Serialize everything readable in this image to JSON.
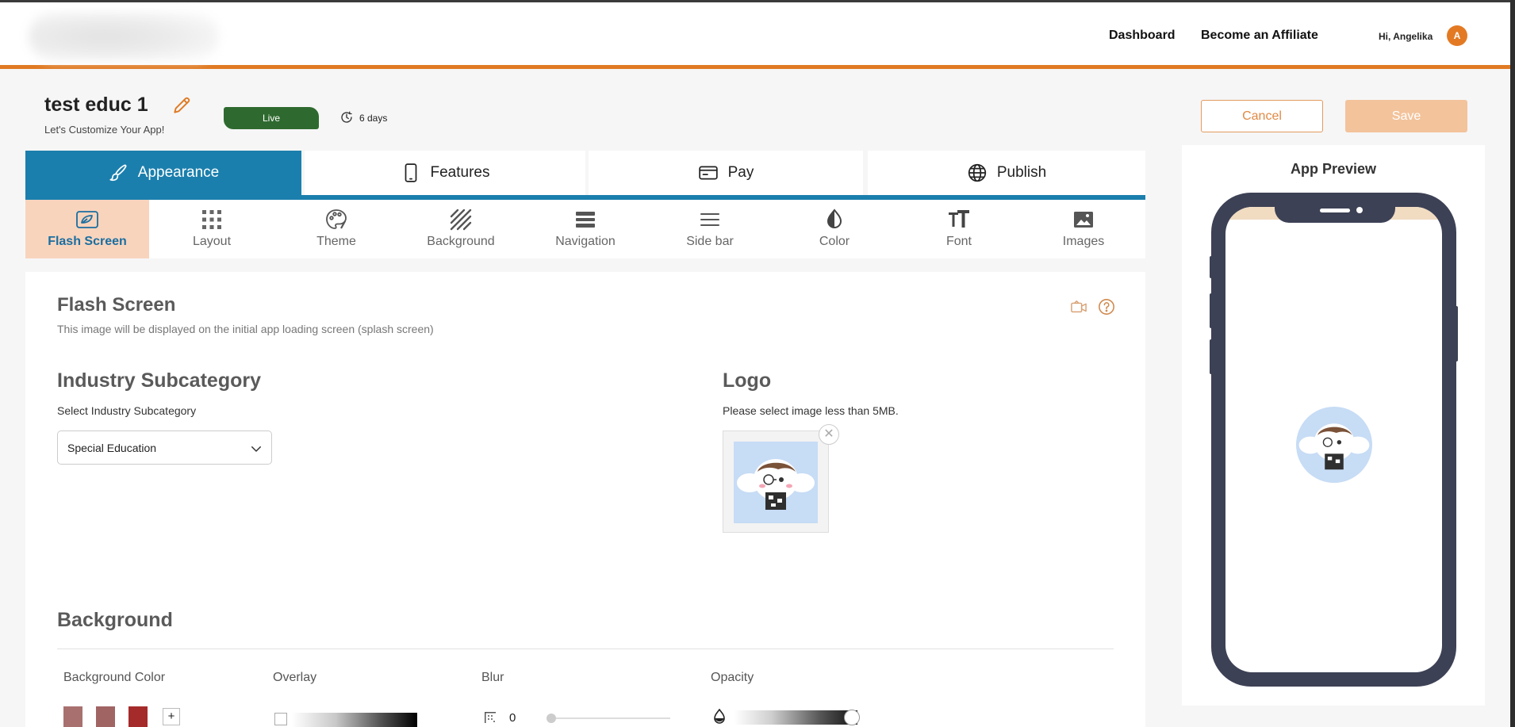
{
  "header": {
    "nav": [
      {
        "label": "Dashboard"
      },
      {
        "label": "Become an Affiliate"
      }
    ],
    "greeting": "Hi, Angelika",
    "avatar_initial": "A",
    "accent_color": "#e07a23"
  },
  "project": {
    "name": "test educ 1",
    "subtitle": "Let's Customize Your App!",
    "status": "Live",
    "status_color": "#2e6a2f",
    "days_left": "6 days"
  },
  "actions": {
    "cancel_label": "Cancel",
    "save_label": "Save"
  },
  "tabs": [
    {
      "label": "Appearance",
      "icon": "brush-icon",
      "active": true
    },
    {
      "label": "Features",
      "icon": "phone-icon",
      "active": false
    },
    {
      "label": "Pay",
      "icon": "card-icon",
      "active": false
    },
    {
      "label": "Publish",
      "icon": "globe-icon",
      "active": false
    }
  ],
  "subtabs": [
    {
      "label": "Flash Screen",
      "icon": "flash-screen-icon",
      "active": true
    },
    {
      "label": "Layout",
      "icon": "grid-icon",
      "active": false
    },
    {
      "label": "Theme",
      "icon": "palette-icon",
      "active": false
    },
    {
      "label": "Background",
      "icon": "hatch-icon",
      "active": false
    },
    {
      "label": "Navigation",
      "icon": "navigation-icon",
      "active": false
    },
    {
      "label": "Side bar",
      "icon": "menu-icon",
      "active": false
    },
    {
      "label": "Color",
      "icon": "droplet-icon",
      "active": false
    },
    {
      "label": "Font",
      "icon": "font-icon",
      "active": false
    },
    {
      "label": "Images",
      "icon": "image-icon",
      "active": false
    }
  ],
  "flash_screen": {
    "title": "Flash Screen",
    "description": "This image will be displayed on the initial app loading screen (splash screen)"
  },
  "industry": {
    "title": "Industry Subcategory",
    "label": "Select Industry Subcategory",
    "selected": "Special Education"
  },
  "logo": {
    "title": "Logo",
    "hint": "Please select image less than 5MB."
  },
  "background": {
    "title": "Background",
    "color_label": "Background Color",
    "overlay_label": "Overlay",
    "blur_label": "Blur",
    "blur_value": "0",
    "opacity_label": "Opacity",
    "opacity_level": 0.95,
    "swatches": [
      "#a8716f",
      "#a06463",
      "#a52a2a"
    ],
    "add_label": "+"
  },
  "preview": {
    "title": "App Preview",
    "topbar_color": "#f1dcc2",
    "phone_color": "#3d4155"
  }
}
